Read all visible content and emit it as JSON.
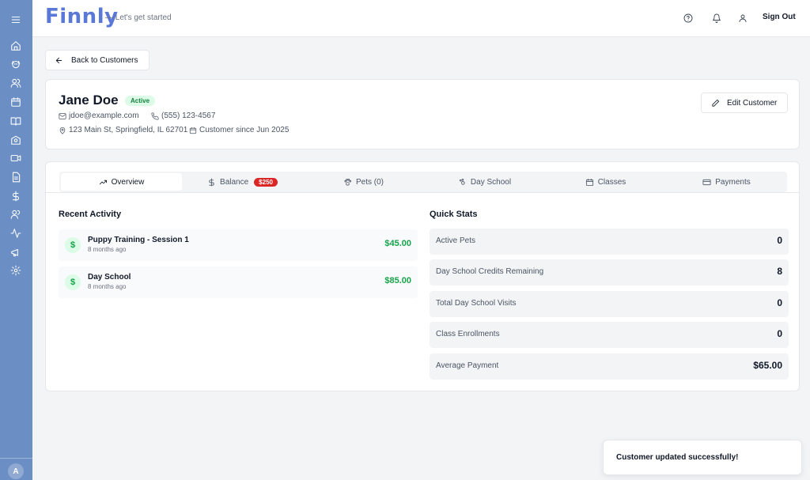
{
  "app": {
    "logo": "Finnly",
    "tagline": "— Let's get started"
  },
  "sidebar": {
    "icons": [
      "menu-icon",
      "home-icon",
      "dog-icon",
      "users-icon",
      "calendar-icon",
      "book-icon",
      "school-icon",
      "video-icon",
      "document-icon",
      "dollar-icon",
      "staff-icon",
      "activity-icon",
      "megaphone-icon",
      "gear-icon"
    ],
    "avatar": "A",
    "color": "#6b8fc4"
  },
  "header": {
    "icons": [
      "help-icon",
      "bell-icon",
      "user-icon"
    ],
    "sign_out": "Sign Out"
  },
  "back_button": "Back to Customers",
  "customer": {
    "name": "Jane Doe",
    "status": "Active",
    "email": "jdoe@example.com",
    "phone": "(555) 123-4567",
    "address": "123 Main St, Springfield, IL 62701",
    "since": "Customer since Jun 2025",
    "edit_label": "Edit Customer"
  },
  "tabs": [
    {
      "label": "Overview",
      "icon": "trending-up-icon",
      "active": true
    },
    {
      "label": "Balance",
      "icon": "dollar-icon",
      "badge": "$250"
    },
    {
      "label": "Pets (0)",
      "icon": "paw-icon"
    },
    {
      "label": "Day School",
      "icon": "paw-print-icon"
    },
    {
      "label": "Classes",
      "icon": "calendar-icon"
    },
    {
      "label": "Payments",
      "icon": "credit-card-icon"
    }
  ],
  "recent_activity": {
    "title": "Recent Activity",
    "items": [
      {
        "title": "Puppy Training - Session 1",
        "time": "8 months ago",
        "amount": "$45.00"
      },
      {
        "title": "Day School",
        "time": "8 months ago",
        "amount": "$85.00"
      }
    ]
  },
  "quick_stats": {
    "title": "Quick Stats",
    "items": [
      {
        "label": "Active Pets",
        "value": "0"
      },
      {
        "label": "Day School Credits Remaining",
        "value": "8"
      },
      {
        "label": "Total Day School Visits",
        "value": "0"
      },
      {
        "label": "Class Enrollments",
        "value": "0"
      },
      {
        "label": "Average Payment",
        "value": "$65.00"
      }
    ]
  },
  "toast": "Customer updated successfully!",
  "colors": {
    "accent": "#5a78d6",
    "success": "#16a34a",
    "danger": "#dc2626"
  }
}
